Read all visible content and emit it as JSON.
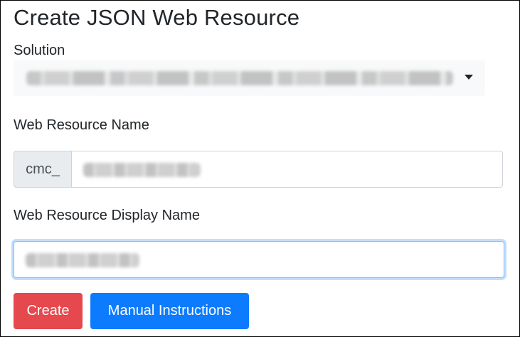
{
  "page": {
    "title": "Create JSON Web Resource"
  },
  "form": {
    "solution": {
      "label": "Solution",
      "selected_value": "",
      "value_redacted": true
    },
    "web_resource_name": {
      "label": "Web Resource Name",
      "prefix": "cmc_",
      "value": "",
      "value_redacted": true
    },
    "web_resource_display_name": {
      "label": "Web Resource Display Name",
      "value": "",
      "value_redacted": true,
      "focused": true
    }
  },
  "actions": {
    "create_label": "Create",
    "manual_label": "Manual Instructions"
  },
  "colors": {
    "create_button": "#e5484d",
    "manual_button": "#0d7bfd",
    "focus_border": "#80bdff",
    "prefix_bg": "#e9ecef",
    "select_bg": "#f8f9fa"
  },
  "icons": {
    "select_caret": "caret-down-icon"
  }
}
